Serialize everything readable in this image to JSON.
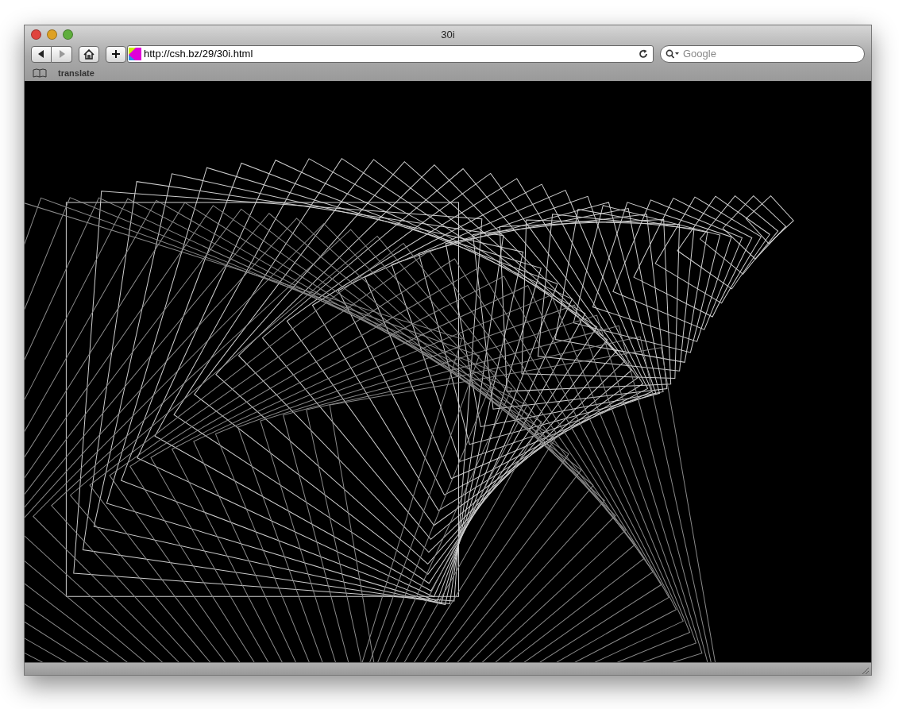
{
  "window": {
    "title": "30i"
  },
  "toolbar": {
    "back": {
      "disabled": false
    },
    "forward": {
      "disabled": true
    },
    "address": {
      "value": "http://csh.bz/29/30i.html"
    },
    "search": {
      "placeholder": "Google"
    }
  },
  "bookmarks_bar": {
    "items": [
      {
        "label": "translate"
      }
    ]
  }
}
